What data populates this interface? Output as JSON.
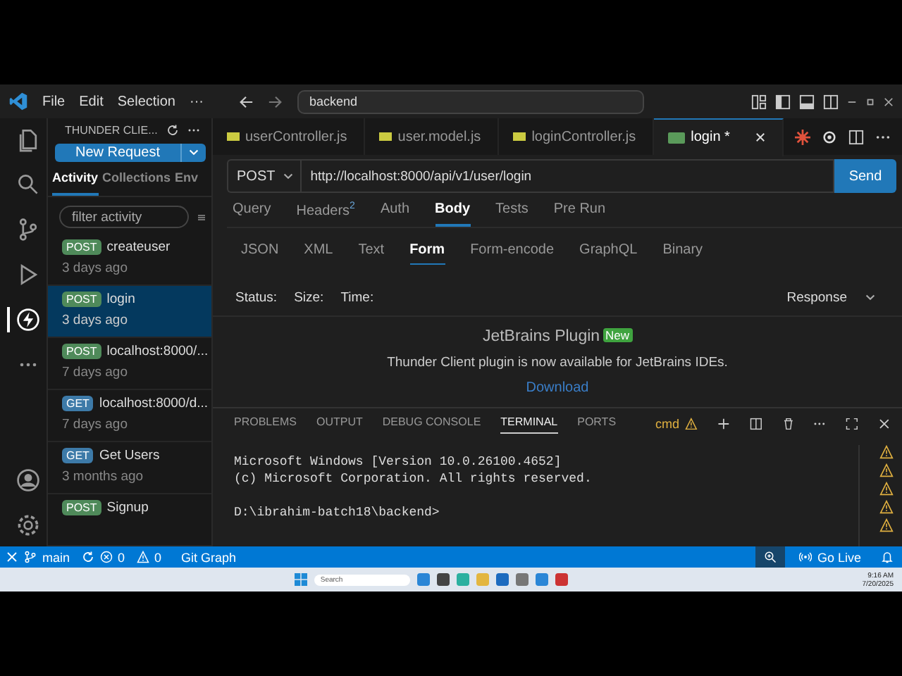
{
  "menu": [
    "File",
    "Edit",
    "Selection",
    "···"
  ],
  "search": {
    "value": "backend"
  },
  "activity_bar": [
    {
      "kind": "files",
      "selected": false
    },
    {
      "kind": "search",
      "selected": false
    },
    {
      "kind": "git",
      "selected": false
    },
    {
      "kind": "debug",
      "selected": false
    },
    {
      "kind": "thunder",
      "selected": true
    },
    {
      "kind": "more",
      "selected": false
    }
  ],
  "sidebar": {
    "title": "THUNDER CLIE...",
    "new_request": "New Request",
    "tabs": [
      {
        "label": "Activity",
        "selected": true
      },
      {
        "label": "Collections",
        "selected": false
      },
      {
        "label": "Env",
        "selected": false
      }
    ],
    "filter": {
      "placeholder": "filter activity"
    },
    "items": [
      {
        "method": "POST",
        "name": "createuser",
        "time": "3 days ago",
        "selected": false
      },
      {
        "method": "POST",
        "name": "login",
        "time": "3 days ago",
        "selected": true
      },
      {
        "method": "POST",
        "name": "localhost:8000/...",
        "time": "7 days ago",
        "selected": false
      },
      {
        "method": "GET",
        "name": "localhost:8000/d...",
        "time": "7 days ago",
        "selected": false
      },
      {
        "method": "GET",
        "name": "Get Users",
        "time": "3 months ago",
        "selected": false
      },
      {
        "method": "POST",
        "name": "Signup",
        "selected": false
      }
    ]
  },
  "editor_tabs": [
    {
      "kind": "js",
      "label": "userController.js",
      "selected": false
    },
    {
      "kind": "js",
      "label": "user.model.js",
      "selected": false
    },
    {
      "kind": "js",
      "label": "loginController.js",
      "selected": false
    },
    {
      "kind": "req",
      "label": "login *",
      "selected": true
    }
  ],
  "request": {
    "method": "POST",
    "url": "http://localhost:8000/api/v1/user/login",
    "send": "Send",
    "tabs": [
      {
        "label": "Query",
        "selected": false
      },
      {
        "label": "Headers",
        "count": "2",
        "selected": false
      },
      {
        "label": "Auth",
        "selected": false
      },
      {
        "label": "Body",
        "selected": true
      },
      {
        "label": "Tests",
        "selected": false
      },
      {
        "label": "Pre Run",
        "selected": false
      }
    ],
    "body_tabs": [
      {
        "label": "JSON",
        "selected": false
      },
      {
        "label": "XML",
        "selected": false
      },
      {
        "label": "Text",
        "selected": false
      },
      {
        "label": "Form",
        "selected": true
      },
      {
        "label": "Form-encode",
        "selected": false
      },
      {
        "label": "GraphQL",
        "selected": false
      },
      {
        "label": "Binary",
        "selected": false
      }
    ]
  },
  "response": {
    "labels": [
      "Status:",
      "Size:",
      "Time:"
    ],
    "dropdown": "Response",
    "promo_title": "JetBrains Plugin",
    "promo_badge": "New",
    "promo_text": "Thunder Client plugin is now available for JetBrains IDEs.",
    "promo_link": "Download"
  },
  "panel": {
    "tabs": [
      {
        "label": "PROBLEMS",
        "selected": false
      },
      {
        "label": "OUTPUT",
        "selected": false
      },
      {
        "label": "DEBUG CONSOLE",
        "selected": false
      },
      {
        "label": "TERMINAL",
        "selected": true
      },
      {
        "label": "PORTS",
        "selected": false
      }
    ],
    "shell": "cmd",
    "blocks": [
      [
        "Microsoft Windows [Version 10.0.26100.4652]",
        "(c) Microsoft Corporation. All rights reserved."
      ],
      [
        "D:\\ibrahim-batch18\\backend>"
      ]
    ]
  },
  "status_bar": {
    "branch": "main",
    "errors": "0",
    "warnings": "0",
    "git_graph": "Git Graph",
    "go_live": "Go Live"
  },
  "taskbar": {
    "search_placeholder": "Search",
    "time": "9:16 AM",
    "date": "7/20/2025"
  }
}
